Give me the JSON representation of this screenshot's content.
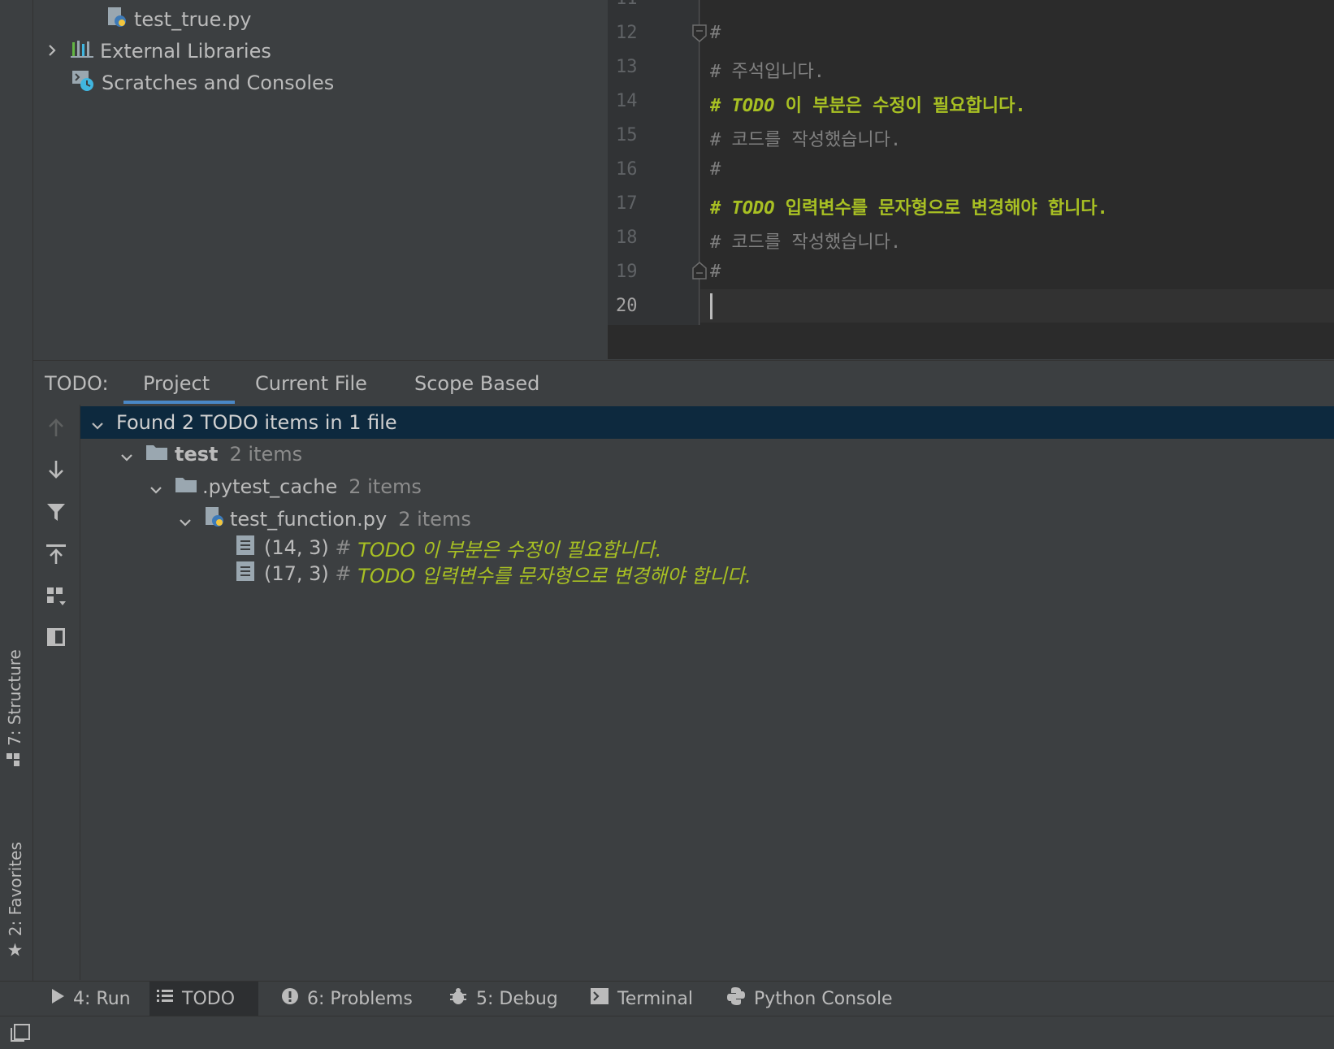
{
  "project_tree": {
    "items": [
      {
        "label": "test_true.py",
        "icon": "python-file-icon"
      },
      {
        "label": "External Libraries",
        "icon": "libraries-icon"
      },
      {
        "label": "Scratches and Consoles",
        "icon": "scratches-icon"
      }
    ]
  },
  "editor": {
    "partial_line_number": "11",
    "lines": [
      {
        "num": "12",
        "hash": "#",
        "text": ""
      },
      {
        "num": "13",
        "hash": "#",
        "text": " 주석입니다."
      },
      {
        "num": "14",
        "hash": "#",
        "keyword": "TODO",
        "text": " 이 부분은 수정이 필요합니다."
      },
      {
        "num": "15",
        "hash": "#",
        "text": " 코드를 작성했습니다."
      },
      {
        "num": "16",
        "hash": "#",
        "text": ""
      },
      {
        "num": "17",
        "hash": "#",
        "keyword": "TODO",
        "text": " 입력변수를 문자형으로 변경해야 합니다."
      },
      {
        "num": "18",
        "hash": "#",
        "text": " 코드를 작성했습니다."
      },
      {
        "num": "19",
        "hash": "#",
        "text": ""
      },
      {
        "num": "20",
        "hash": "",
        "text": ""
      }
    ]
  },
  "todo_panel": {
    "title": "TODO:",
    "tabs": [
      "Project",
      "Current File",
      "Scope Based"
    ],
    "active_tab": "Project",
    "summary": "Found 2 TODO items in 1 file",
    "tree": {
      "folder": {
        "label": "test",
        "count": "2 items"
      },
      "subfolder": {
        "label": ".pytest_cache",
        "count": "2 items"
      },
      "file": {
        "label": "test_function.py",
        "count": "2 items"
      },
      "items": [
        {
          "pos": "(14, 3)",
          "hash": "#",
          "text": "TODO 이 부분은 수정이 필요합니다."
        },
        {
          "pos": "(17, 3)",
          "hash": "#",
          "text": "TODO 입력변수를 문자형으로 변경해야 합니다."
        }
      ]
    }
  },
  "left_strip": {
    "structure": "7: Structure",
    "favorites": "2: Favorites"
  },
  "bottom_bar": {
    "items": [
      {
        "label": "4: Run",
        "icon": "run-icon"
      },
      {
        "label": "TODO",
        "icon": "todo-list-icon"
      },
      {
        "label": "6: Problems",
        "icon": "problems-icon"
      },
      {
        "label": "5: Debug",
        "icon": "debug-icon"
      },
      {
        "label": "Terminal",
        "icon": "terminal-icon"
      },
      {
        "label": "Python Console",
        "icon": "python-console-icon"
      }
    ],
    "active": "TODO"
  },
  "colors": {
    "todo_highlight": "#a8c023",
    "selection": "#0d293e",
    "tab_underline": "#4a88c7"
  }
}
